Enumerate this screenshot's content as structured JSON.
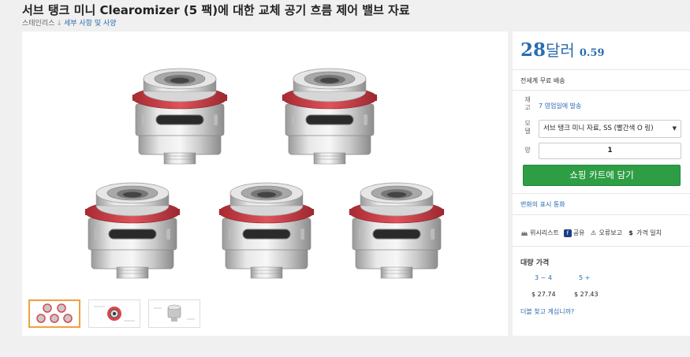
{
  "product": {
    "title": "서브 탱크 미니 Clearomizer (5 팩)에 대한 교체 공기 흐름 제어 밸브 자료",
    "material": "스테인리스",
    "material_arrow": "↓",
    "details_link": "세부 사항 및 사양"
  },
  "gallery": {
    "thumbnails": [
      {
        "label": "thumbnail-1",
        "active": true
      },
      {
        "label": "thumbnail-2",
        "active": false
      },
      {
        "label": "thumbnail-3",
        "active": false
      }
    ]
  },
  "price": {
    "main": "28",
    "unit": "달러",
    "cents": "0.59"
  },
  "shipping": "전세계 무료 배송",
  "stock": {
    "label": "재고",
    "value": "7 영업일에 발송"
  },
  "model": {
    "label": "모델",
    "selected": "서브 탱크 미니 자료, SS (빨간색 O 링)",
    "caret": "▼"
  },
  "quantity": {
    "label": "양",
    "value": "1"
  },
  "cart_button": "쇼핑 카트에 담기",
  "history_link": "변화의 표시 통화",
  "actions": {
    "wishlist": "위시리스트",
    "share": "공유",
    "report": "오류보고",
    "price_match": "가격 일치"
  },
  "icons": {
    "wishlist": "wishlist-icon",
    "share": "share-icon",
    "report": "warning-icon",
    "price_match": "dollar-icon"
  },
  "bulk": {
    "title": "대량 가격",
    "tiers": [
      {
        "range": "3 ~ 4",
        "price": "$ 27.74"
      },
      {
        "range": "5 +",
        "price": "$ 27.43"
      }
    ]
  },
  "inquiry_link": "더블 찾고 계십니까?",
  "colors": {
    "accent": "#2a6cb0",
    "cart": "#2e9e45",
    "ring_red": "#d8464e"
  }
}
